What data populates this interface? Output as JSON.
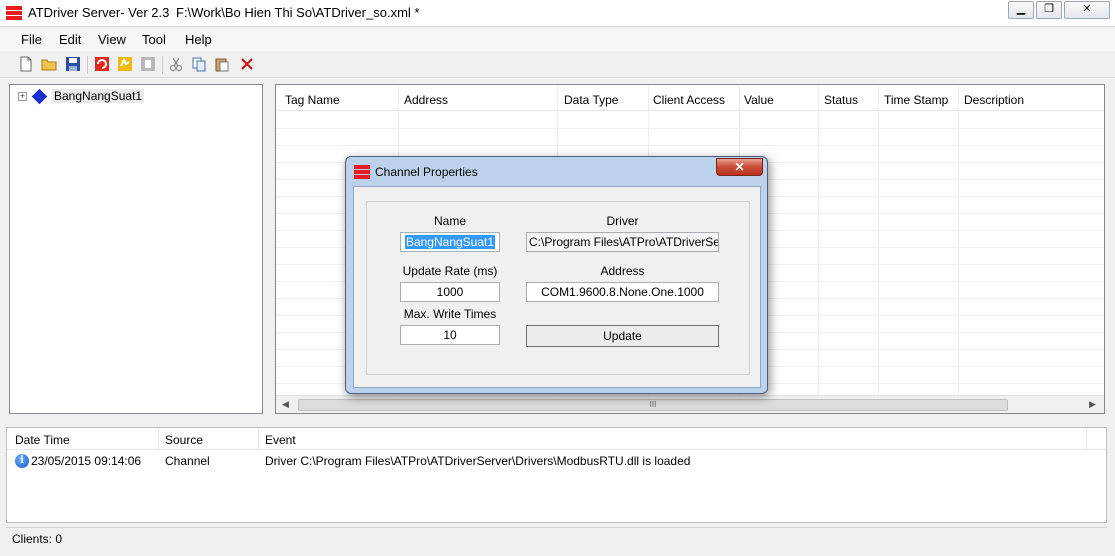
{
  "window": {
    "app_title": "ATDriver Server- Ver 2.3",
    "file_path": "F:\\Work\\Bo Hien Thi So\\ATDriver_so.xml *"
  },
  "menu": {
    "items": [
      {
        "label": "File"
      },
      {
        "label": "Edit"
      },
      {
        "label": "View"
      },
      {
        "label": "Tool"
      },
      {
        "label": "Help"
      }
    ]
  },
  "toolbar": {
    "icons": [
      "new-file-icon",
      "open-folder-icon",
      "save-icon",
      "add-channel-icon",
      "add-device-icon",
      "add-tag-icon",
      "cut-icon",
      "copy-icon",
      "paste-icon",
      "delete-icon"
    ]
  },
  "tree": {
    "items": [
      {
        "label": "BangNangSuat1"
      }
    ]
  },
  "grid": {
    "columns": [
      "Tag Name",
      "Address",
      "Data Type",
      "Client Access",
      "Value",
      "Status",
      "Time Stamp",
      "Description"
    ],
    "scroll_grip": "III"
  },
  "log": {
    "columns": [
      "Date Time",
      "Source",
      "Event"
    ],
    "rows": [
      {
        "datetime": "23/05/2015 09:14:06",
        "source": "Channel",
        "event": "Driver C:\\Program Files\\ATPro\\ATDriverServer\\Drivers\\ModbusRTU.dll is loaded"
      }
    ]
  },
  "status": {
    "clients": "Clients: 0"
  },
  "dialog": {
    "title": "Channel Properties",
    "close_glyph": "✕",
    "name_label": "Name",
    "name_value": "BangNangSuat1",
    "driver_label": "Driver",
    "driver_value": "C:\\Program Files\\ATPro\\ATDriverServe",
    "update_rate_label": "Update Rate (ms)",
    "update_rate_value": "1000",
    "address_label": "Address",
    "address_value": "COM1.9600.8.None.One.1000",
    "max_write_label": "Max. Write Times",
    "max_write_value": "10",
    "update_button": "Update"
  },
  "colors": {
    "brand_red": "#e81c1c",
    "tree_node": "#1a2fd0",
    "dialog_frame": "#bcd2ea",
    "selection": "#3399ff"
  }
}
